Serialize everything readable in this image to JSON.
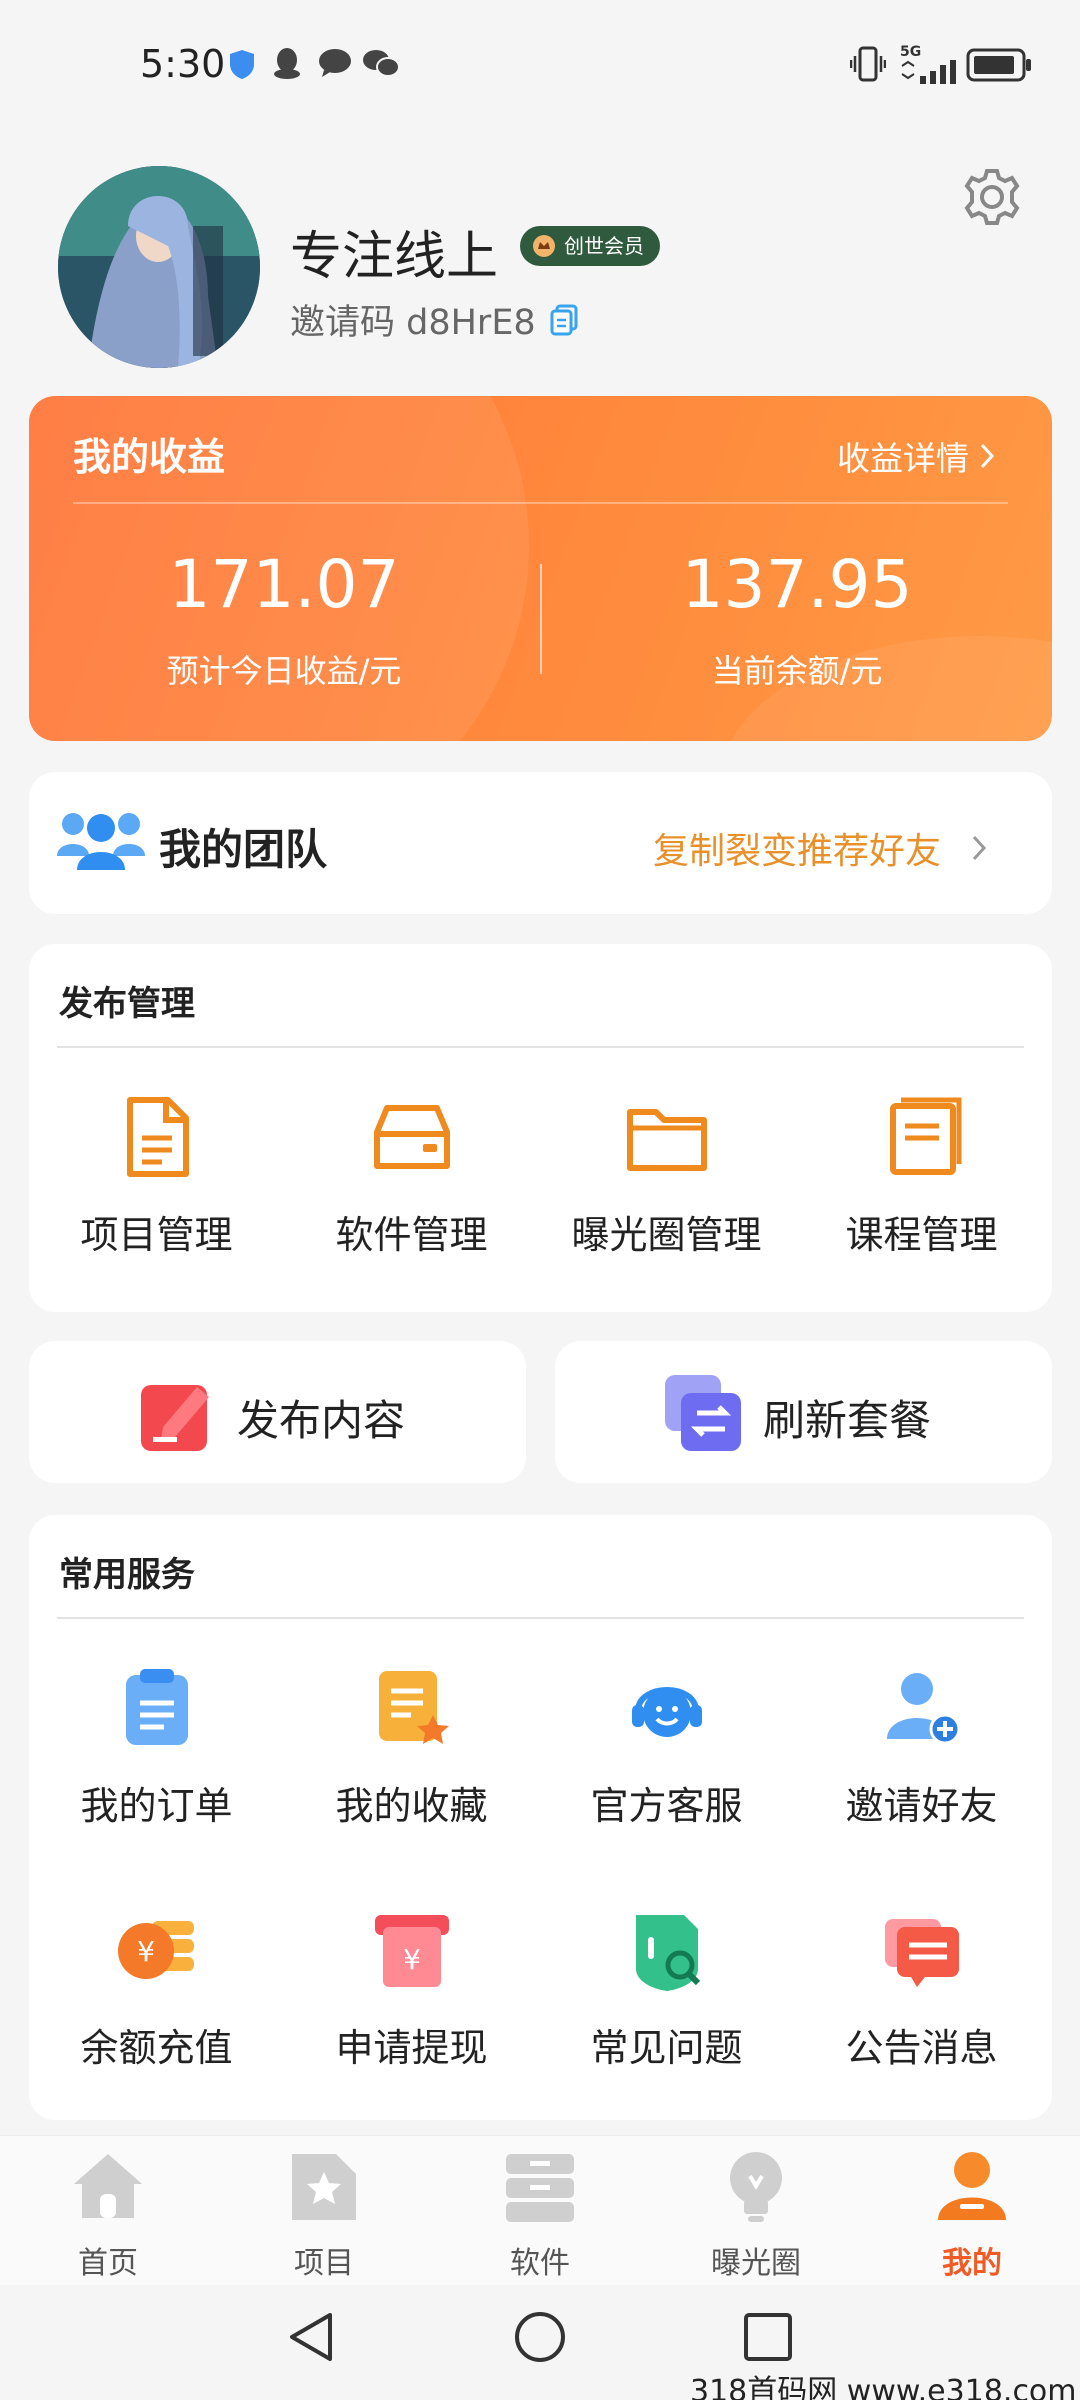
{
  "status": {
    "time": "5:30",
    "network": "5G"
  },
  "profile": {
    "username": "专注线上",
    "badge": "创世会员",
    "invite_label": "邀请码 d8HrE8"
  },
  "earnings": {
    "title": "我的收益",
    "detail_link": "收益详情",
    "today_value": "171.07",
    "today_label": "预计今日收益/元",
    "balance_value": "137.95",
    "balance_label": "当前余额/元"
  },
  "team": {
    "title": "我的团队",
    "link": "复制裂变推荐好友"
  },
  "publish": {
    "title": "发布管理",
    "items": [
      {
        "label": "项目管理",
        "icon": "document-icon"
      },
      {
        "label": "软件管理",
        "icon": "drive-icon"
      },
      {
        "label": "曝光圈管理",
        "icon": "folder-icon"
      },
      {
        "label": "课程管理",
        "icon": "book-icon"
      }
    ]
  },
  "actions": {
    "publish_content": "发布内容",
    "refresh_plan": "刷新套餐"
  },
  "services": {
    "title": "常用服务",
    "items": [
      {
        "label": "我的订单",
        "icon": "order-icon"
      },
      {
        "label": "我的收藏",
        "icon": "favorite-icon"
      },
      {
        "label": "官方客服",
        "icon": "headset-icon"
      },
      {
        "label": "邀请好友",
        "icon": "invite-user-icon"
      },
      {
        "label": "余额充值",
        "icon": "recharge-icon"
      },
      {
        "label": "申请提现",
        "icon": "withdraw-icon"
      },
      {
        "label": "常见问题",
        "icon": "faq-icon"
      },
      {
        "label": "公告消息",
        "icon": "notice-icon"
      }
    ]
  },
  "tabbar": {
    "items": [
      {
        "label": "首页",
        "icon": "home-icon"
      },
      {
        "label": "项目",
        "icon": "project-icon"
      },
      {
        "label": "软件",
        "icon": "software-icon"
      },
      {
        "label": "曝光圈",
        "icon": "bulb-icon"
      },
      {
        "label": "我的",
        "icon": "profile-icon"
      }
    ],
    "active": "我的"
  },
  "watermark": "318首码网 www.e318.com",
  "colors": {
    "accent": "#ff7a36",
    "active_tab": "#f15a24",
    "team_link": "#e8912a",
    "badge_bg": "#2f5a3d"
  }
}
